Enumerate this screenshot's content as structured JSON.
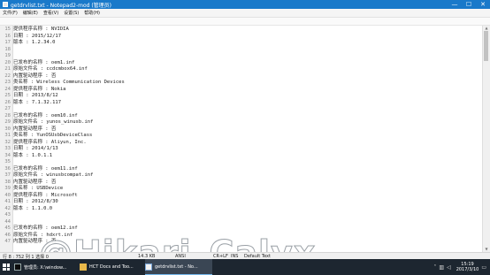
{
  "window": {
    "title": "getdrvlist.txt - Notepad2-mod (管理员)",
    "controls": {
      "minimize": "—",
      "maximize": "☐",
      "close": "✕"
    }
  },
  "menu": [
    "文件(F)",
    "编辑(E)",
    "查看(V)",
    "设置(S)",
    "帮助(H)"
  ],
  "editor": {
    "lines": [
      {
        "n": "15",
        "t": "提供程序名称 : NVIDIA"
      },
      {
        "n": "16",
        "t": "日期 : 2015/12/17"
      },
      {
        "n": "17",
        "t": "版本 : 1.2.34.0"
      },
      {
        "n": "18",
        "t": ""
      },
      {
        "n": "19",
        "t": ""
      },
      {
        "n": "20",
        "t": "已发布的名称 : oem1.inf"
      },
      {
        "n": "21",
        "t": "原始文件名 : ccdcmbox64.inf"
      },
      {
        "n": "22",
        "t": "内置驱动程序 : 否"
      },
      {
        "n": "23",
        "t": "类名称 : Wireless Communication Devices"
      },
      {
        "n": "24",
        "t": "提供程序名称 : Nokia"
      },
      {
        "n": "25",
        "t": "日期 : 2013/8/12"
      },
      {
        "n": "26",
        "t": "版本 : 7.1.32.117"
      },
      {
        "n": "27",
        "t": ""
      },
      {
        "n": "28",
        "t": "已发布的名称 : oem10.inf"
      },
      {
        "n": "29",
        "t": "原始文件名 : yunos_winusb.inf"
      },
      {
        "n": "30",
        "t": "内置驱动程序 : 否"
      },
      {
        "n": "31",
        "t": "类名称 : YunOSUsbDeviceClass"
      },
      {
        "n": "32",
        "t": "提供程序名称 : Aliyun, Inc."
      },
      {
        "n": "33",
        "t": "日期 : 2014/1/13"
      },
      {
        "n": "34",
        "t": "版本 : 1.0.1.1"
      },
      {
        "n": "35",
        "t": ""
      },
      {
        "n": "36",
        "t": "已发布的名称 : oem11.inf"
      },
      {
        "n": "37",
        "t": "原始文件名 : winusbcompat.inf"
      },
      {
        "n": "38",
        "t": "内置驱动程序 : 否"
      },
      {
        "n": "39",
        "t": "类名称 : USBDevice"
      },
      {
        "n": "40",
        "t": "提供程序名称 : Microsoft"
      },
      {
        "n": "41",
        "t": "日期 : 2012/8/30"
      },
      {
        "n": "42",
        "t": "版本 : 1.1.0.0"
      },
      {
        "n": "43",
        "t": ""
      },
      {
        "n": "44",
        "t": ""
      },
      {
        "n": "45",
        "t": "已发布的名称 : oem12.inf"
      },
      {
        "n": "46",
        "t": "原始文件名 : hdxrt.inf"
      },
      {
        "n": "47",
        "t": "内置驱动程序 : 否"
      }
    ]
  },
  "watermark": "@Hikari_Calyx",
  "statusbar": {
    "position": "行 8 : 752  列 1  选择 0",
    "size": "14.3 KB",
    "encoding": "ANSI",
    "eol": "CR+LF",
    "ins": "INS",
    "scheme": "Default Text"
  },
  "taskbar": {
    "tasks": [
      {
        "label": "管理员: X:\\window...",
        "icon": "console-icon"
      },
      {
        "label": "HCT Docs and Too...",
        "icon": "folder-icon"
      },
      {
        "label": "getdrvlist.txt - No...",
        "icon": "notepad-icon"
      }
    ],
    "time": "15:19",
    "date": "2017/3/10"
  },
  "colors": {
    "titlebar": "#1979ca",
    "taskbar": "#1d2630",
    "line_numbers": "#8a8a8a"
  }
}
